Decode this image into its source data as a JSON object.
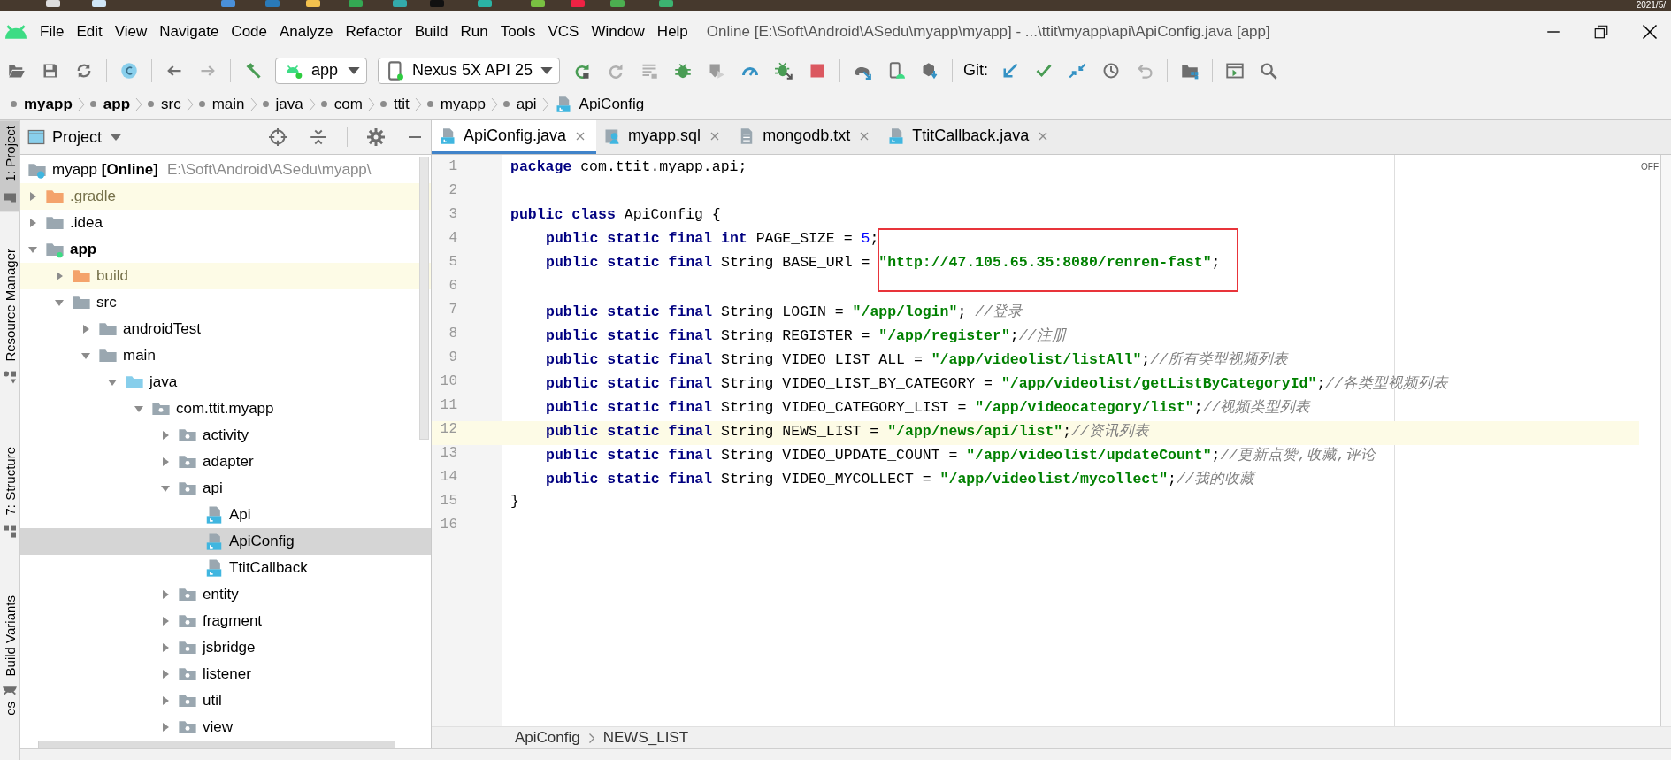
{
  "taskbar": {
    "clock": "2021/5/"
  },
  "menu": [
    "File",
    "Edit",
    "View",
    "Navigate",
    "Code",
    "Analyze",
    "Refactor",
    "Build",
    "Run",
    "Tools",
    "VCS",
    "Window",
    "Help"
  ],
  "window": {
    "title": "Online [E:\\Soft\\Android\\ASedu\\myapp\\myapp] - ...\\ttit\\myapp\\api\\ApiConfig.java [app]"
  },
  "toolbar": {
    "run_config": "app",
    "device": "Nexus 5X API 25",
    "git_label": "Git:"
  },
  "navigation_bar": [
    {
      "label": "myapp",
      "kind": "module"
    },
    {
      "label": "app",
      "kind": "module"
    },
    {
      "label": "src",
      "kind": "directory"
    },
    {
      "label": "main",
      "kind": "directory"
    },
    {
      "label": "java",
      "kind": "directory"
    },
    {
      "label": "com",
      "kind": "directory"
    },
    {
      "label": "ttit",
      "kind": "directory"
    },
    {
      "label": "myapp",
      "kind": "directory"
    },
    {
      "label": "api",
      "kind": "directory"
    },
    {
      "label": "ApiConfig",
      "kind": "class"
    }
  ],
  "tool_stripe": [
    {
      "label": "1: Project",
      "kind": "project",
      "selected": true
    },
    {
      "label": "Resource Manager",
      "kind": "resources",
      "selected": false
    },
    {
      "label": "7: Structure",
      "kind": "structure",
      "selected": false
    },
    {
      "label": "Build Variants",
      "kind": "variants",
      "selected": false
    },
    {
      "label": "es",
      "kind": "favorites",
      "selected": false
    }
  ],
  "project": {
    "title": "Project",
    "tree": [
      {
        "label": "myapp",
        "status": "[Online]",
        "path": "E:\\Soft\\Android\\ASedu\\myapp\\",
        "kind": "project",
        "selected": false,
        "children": [
          {
            "label": ".gradle",
            "kind": "excluded",
            "expanded": false,
            "selected": false
          },
          {
            "label": ".idea",
            "kind": "folder",
            "expanded": false,
            "selected": false
          },
          {
            "label": "app",
            "kind": "module",
            "expanded": true,
            "selected": false,
            "children": [
              {
                "label": "build",
                "kind": "excluded",
                "expanded": false,
                "selected": false
              },
              {
                "label": "src",
                "kind": "folder",
                "expanded": true,
                "selected": false,
                "children": [
                  {
                    "label": "androidTest",
                    "kind": "folder",
                    "expanded": false,
                    "selected": false
                  },
                  {
                    "label": "main",
                    "kind": "folder",
                    "expanded": true,
                    "selected": false,
                    "children": [
                      {
                        "label": "java",
                        "kind": "source",
                        "expanded": true,
                        "selected": false,
                        "children": [
                          {
                            "label": "com.ttit.myapp",
                            "kind": "package",
                            "expanded": true,
                            "selected": false,
                            "children": [
                              {
                                "label": "activity",
                                "kind": "package",
                                "expanded": false,
                                "selected": false
                              },
                              {
                                "label": "adapter",
                                "kind": "package",
                                "expanded": false,
                                "selected": false
                              },
                              {
                                "label": "api",
                                "kind": "package",
                                "expanded": true,
                                "selected": false,
                                "children": [
                                  {
                                    "label": "Api",
                                    "kind": "class",
                                    "selected": false
                                  },
                                  {
                                    "label": "ApiConfig",
                                    "kind": "class",
                                    "selected": true
                                  },
                                  {
                                    "label": "TtitCallback",
                                    "kind": "class",
                                    "selected": false
                                  }
                                ]
                              },
                              {
                                "label": "entity",
                                "kind": "package",
                                "expanded": false,
                                "selected": false
                              },
                              {
                                "label": "fragment",
                                "kind": "package",
                                "expanded": false,
                                "selected": false
                              },
                              {
                                "label": "jsbridge",
                                "kind": "package",
                                "expanded": false,
                                "selected": false
                              },
                              {
                                "label": "listener",
                                "kind": "package",
                                "expanded": false,
                                "selected": false
                              },
                              {
                                "label": "util",
                                "kind": "package",
                                "expanded": false,
                                "selected": false
                              },
                              {
                                "label": "view",
                                "kind": "package",
                                "expanded": false,
                                "selected": false
                              }
                            ]
                          }
                        ]
                      }
                    ]
                  }
                ]
              }
            ]
          }
        ]
      }
    ]
  },
  "editor": {
    "tabs": [
      {
        "label": "ApiConfig.java",
        "kind": "java",
        "selected": true
      },
      {
        "label": "myapp.sql",
        "kind": "sql",
        "selected": false
      },
      {
        "label": "mongodb.txt",
        "kind": "text",
        "selected": false
      },
      {
        "label": "TtitCallback.java",
        "kind": "java",
        "selected": false
      }
    ],
    "lines": [
      {
        "number": "1",
        "indented": false,
        "current": false,
        "tokens": [
          {
            "kind": "keyword",
            "text": "package"
          },
          {
            "kind": "plain",
            "text": " com.ttit.myapp.api;"
          }
        ]
      },
      {
        "number": "2",
        "current": false
      },
      {
        "number": "3",
        "indented": false,
        "current": false,
        "tokens": [
          {
            "kind": "keyword",
            "text": "public class"
          },
          {
            "kind": "plain",
            "text": " ApiConfig {"
          }
        ]
      },
      {
        "number": "4",
        "indented": true,
        "current": false,
        "tokens": [
          {
            "kind": "keyword",
            "text": "public static final int"
          },
          {
            "kind": "plain",
            "text": " PAGE_SIZE = "
          },
          {
            "kind": "number",
            "text": "5"
          },
          {
            "kind": "plain",
            "text": ";"
          }
        ]
      },
      {
        "number": "5",
        "indented": true,
        "current": false,
        "tokens": [
          {
            "kind": "keyword",
            "text": "public static final"
          },
          {
            "kind": "plain",
            "text": " String BASE_URl = "
          },
          {
            "kind": "string",
            "text": "\"http://47.105.65.35:8080/renren-fast\""
          },
          {
            "kind": "plain",
            "text": ";"
          }
        ]
      },
      {
        "number": "6",
        "current": false
      },
      {
        "number": "7",
        "indented": true,
        "current": false,
        "tokens": [
          {
            "kind": "keyword",
            "text": "public static final"
          },
          {
            "kind": "plain",
            "text": " String LOGIN = "
          },
          {
            "kind": "string",
            "text": "\"/app/login\""
          },
          {
            "kind": "plain",
            "text": "; "
          },
          {
            "kind": "comment",
            "text": "//登录"
          }
        ]
      },
      {
        "number": "8",
        "indented": true,
        "current": false,
        "tokens": [
          {
            "kind": "keyword",
            "text": "public static final"
          },
          {
            "kind": "plain",
            "text": " String REGISTER = "
          },
          {
            "kind": "string",
            "text": "\"/app/register\""
          },
          {
            "kind": "plain",
            "text": ";"
          },
          {
            "kind": "comment",
            "text": "//注册"
          }
        ]
      },
      {
        "number": "9",
        "indented": true,
        "current": false,
        "tokens": [
          {
            "kind": "keyword",
            "text": "public static final"
          },
          {
            "kind": "plain",
            "text": " String VIDEO_LIST_ALL = "
          },
          {
            "kind": "string",
            "text": "\"/app/videolist/listAll\""
          },
          {
            "kind": "plain",
            "text": ";"
          },
          {
            "kind": "comment",
            "text": "//所有类型视频列表"
          }
        ]
      },
      {
        "number": "10",
        "indented": true,
        "current": false,
        "tokens": [
          {
            "kind": "keyword",
            "text": "public static final"
          },
          {
            "kind": "plain",
            "text": " String VIDEO_LIST_BY_CATEGORY = "
          },
          {
            "kind": "string",
            "text": "\"/app/videolist/getListByCategoryId\""
          },
          {
            "kind": "plain",
            "text": ";"
          },
          {
            "kind": "comment",
            "text": "//各类型视频列表"
          }
        ]
      },
      {
        "number": "11",
        "indented": true,
        "current": false,
        "tokens": [
          {
            "kind": "keyword",
            "text": "public static final"
          },
          {
            "kind": "plain",
            "text": " String VIDEO_CATEGORY_LIST = "
          },
          {
            "kind": "string",
            "text": "\"/app/videocategory/list\""
          },
          {
            "kind": "plain",
            "text": ";"
          },
          {
            "kind": "comment",
            "text": "//视频类型列表"
          }
        ]
      },
      {
        "number": "12",
        "indented": true,
        "current": true,
        "tokens": [
          {
            "kind": "keyword",
            "text": "public static final"
          },
          {
            "kind": "plain",
            "text": " String NEWS_LIST = "
          },
          {
            "kind": "string",
            "text": "\"/app/news/api/list\""
          },
          {
            "kind": "plain",
            "text": ";"
          },
          {
            "kind": "comment",
            "text": "//资讯列表"
          }
        ]
      },
      {
        "number": "13",
        "indented": true,
        "current": false,
        "tokens": [
          {
            "kind": "keyword",
            "text": "public static final"
          },
          {
            "kind": "plain",
            "text": " String VIDEO_UPDATE_COUNT = "
          },
          {
            "kind": "string",
            "text": "\"/app/videolist/updateCount\""
          },
          {
            "kind": "plain",
            "text": ";"
          },
          {
            "kind": "comment",
            "text": "//更新点赞,收藏,评论"
          }
        ]
      },
      {
        "number": "14",
        "indented": true,
        "current": false,
        "tokens": [
          {
            "kind": "keyword",
            "text": "public static final"
          },
          {
            "kind": "plain",
            "text": " String VIDEO_MYCOLLECT = "
          },
          {
            "kind": "string",
            "text": "\"/app/videolist/mycollect\""
          },
          {
            "kind": "plain",
            "text": ";"
          },
          {
            "kind": "comment",
            "text": "//我的收藏"
          }
        ]
      },
      {
        "number": "15",
        "indented": false,
        "current": false,
        "tokens": [
          {
            "kind": "plain",
            "text": "}"
          }
        ]
      },
      {
        "number": "16",
        "current": false
      }
    ],
    "markup": [
      {
        "kind": "rectangle"
      }
    ],
    "inspection_status": "OFF",
    "breadcrumb": [
      "ApiConfig",
      "NEWS_LIST"
    ]
  }
}
